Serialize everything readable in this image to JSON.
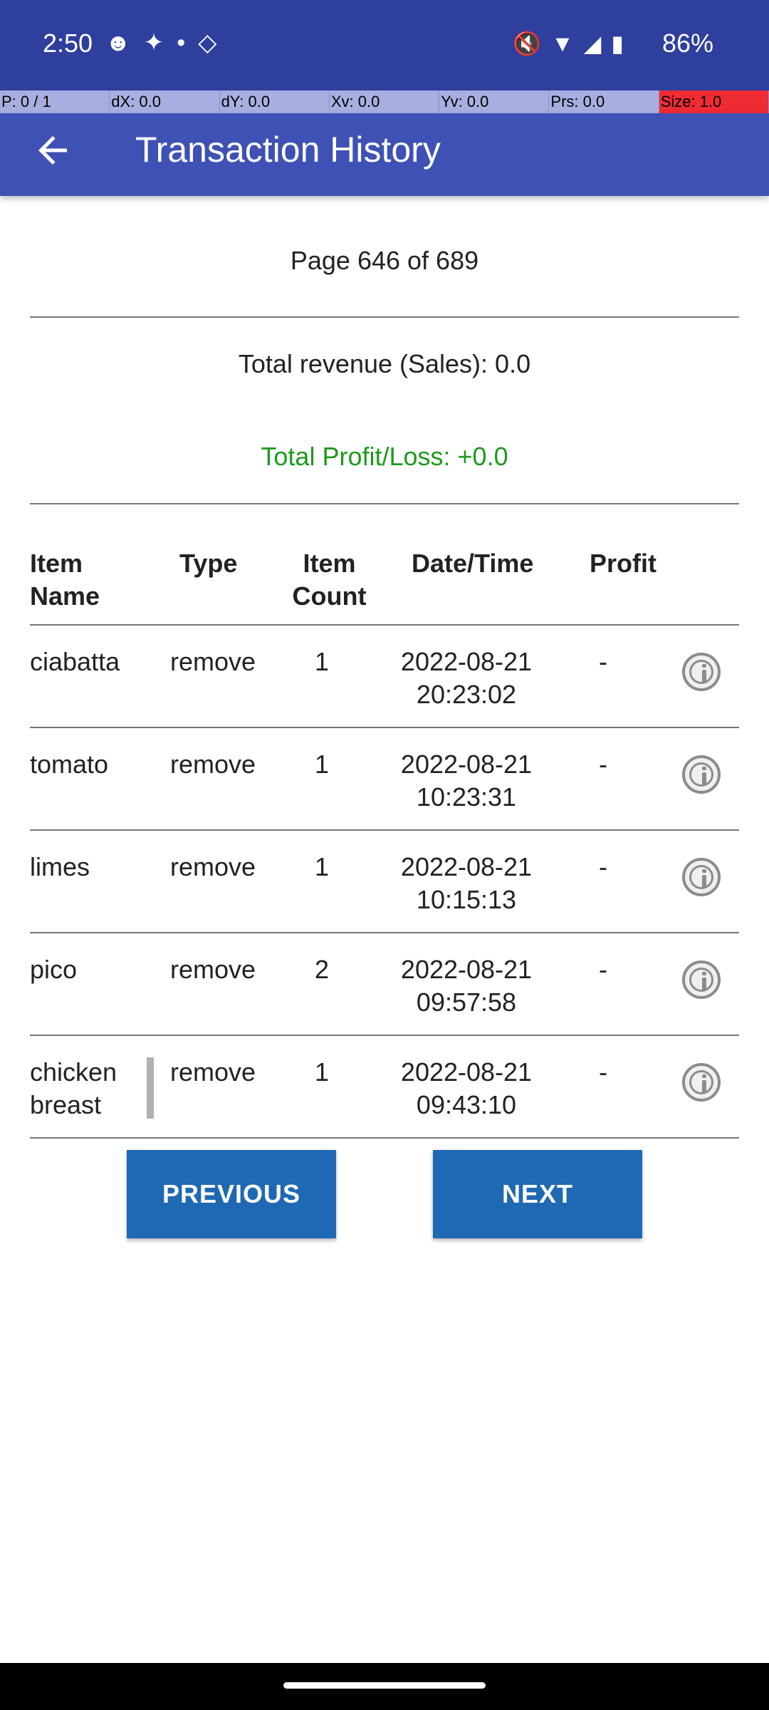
{
  "status_bar": {
    "time": "2:50",
    "left_icons": [
      "snapchat-icon",
      "slack-icon",
      "sparkle-icon",
      "diamond-icon"
    ],
    "right_icons": [
      "mute-icon",
      "wifi-icon",
      "signal-icon",
      "battery-icon"
    ],
    "battery": "86%"
  },
  "pointer_overlay": {
    "p": "P: 0 / 1",
    "dx": "dX: 0.0",
    "dy": "dY: 0.0",
    "xv": "Xv: 0.0",
    "yv": "Yv: 0.0",
    "prs": "Prs: 0.0",
    "size": "Size: 1.0"
  },
  "app_bar": {
    "title": "Transaction History"
  },
  "summary": {
    "page": "Page 646 of 689",
    "revenue": "Total revenue (Sales): 0.0",
    "profit": "Total Profit/Loss: +0.0",
    "profit_color": "#1c9a1c"
  },
  "table": {
    "headers": {
      "item_name": "Item Name",
      "type": "Type",
      "item_count": "Item Count",
      "date_time": "Date/Time",
      "profit": "Profit"
    },
    "rows": [
      {
        "name": "ciabatta",
        "type": "remove",
        "count": "1",
        "date": "2022-08-21",
        "time": "20:23:02",
        "profit": "-"
      },
      {
        "name": "tomato",
        "type": "remove",
        "count": "1",
        "date": "2022-08-21",
        "time": "10:23:31",
        "profit": "-"
      },
      {
        "name": "limes",
        "type": "remove",
        "count": "1",
        "date": "2022-08-21",
        "time": "10:15:13",
        "profit": "-"
      },
      {
        "name": "pico",
        "type": "remove",
        "count": "2",
        "date": "2022-08-21",
        "time": "09:57:58",
        "profit": "-"
      },
      {
        "name": "chicken breast",
        "type": "remove",
        "count": "1",
        "date": "2022-08-21",
        "time": "09:43:10",
        "profit": "-"
      }
    ]
  },
  "buttons": {
    "previous": "PREVIOUS",
    "next": "NEXT"
  },
  "colors": {
    "status_bar": "#2f3f9e",
    "app_bar": "#3f51b5",
    "button": "#1f68b3"
  }
}
